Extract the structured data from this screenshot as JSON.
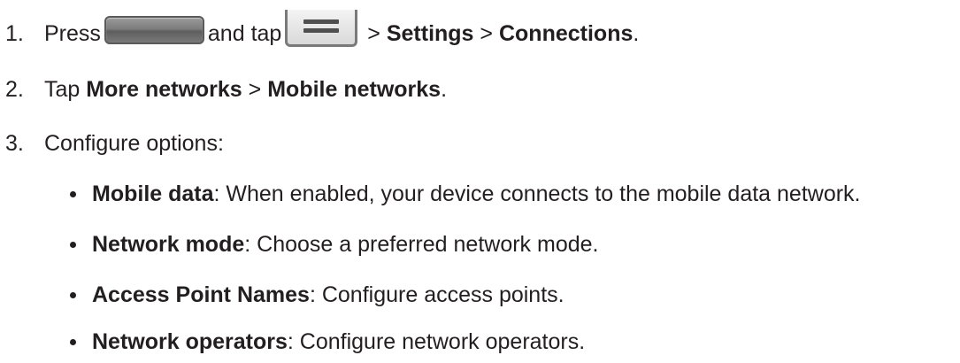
{
  "steps": [
    {
      "number": "1.",
      "pre": "Press",
      "mid": "and tap",
      "sep1": ">",
      "b1": "Settings",
      "sep2": ">",
      "b2": "Connections",
      "end": "."
    },
    {
      "number": "2.",
      "pre": "Tap",
      "b1": "More networks",
      "sep1": ">",
      "b2": "Mobile networks",
      "end": "."
    },
    {
      "number": "3.",
      "text": "Configure options:"
    }
  ],
  "options": [
    {
      "term": "Mobile data",
      "desc": ": When enabled, your device connects to the mobile data network."
    },
    {
      "term": "Network mode",
      "desc": ": Choose a preferred network mode."
    },
    {
      "term": "Access Point Names",
      "desc": ": Configure access points."
    },
    {
      "term": "Network operators",
      "desc": ": Configure network operators."
    }
  ],
  "icons": {
    "home_key": "home-key-icon",
    "menu_key": "menu-key-icon"
  }
}
